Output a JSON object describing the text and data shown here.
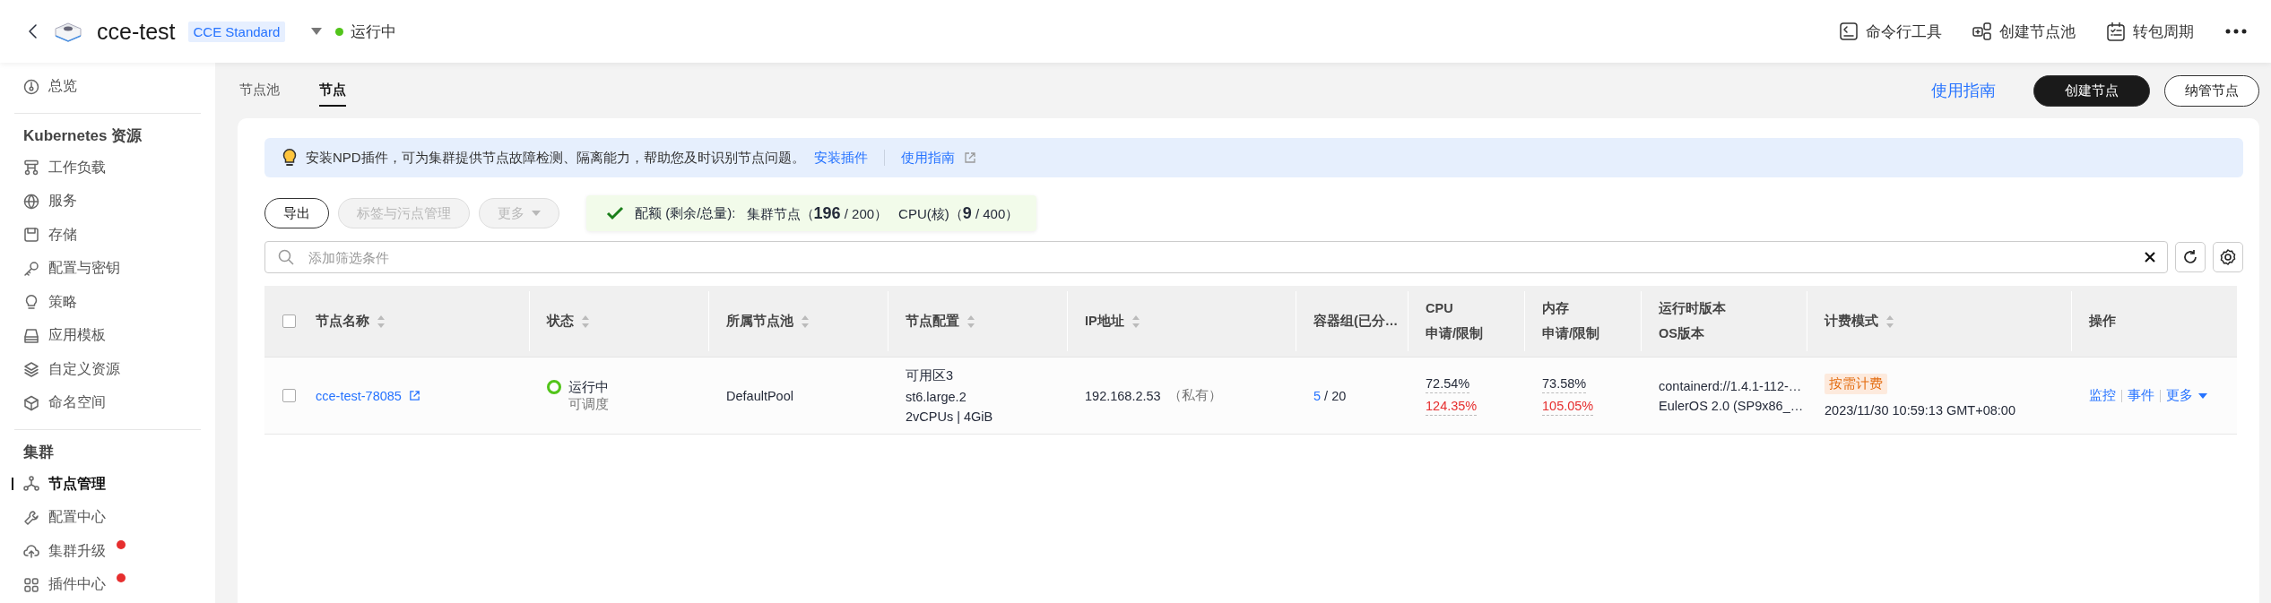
{
  "header": {
    "title": "cce-test",
    "edition": "CCE Standard",
    "status": {
      "label": "运行中",
      "color": "#52c41a"
    },
    "actions": [
      {
        "label": "命令行工具"
      },
      {
        "label": "创建节点池"
      },
      {
        "label": "转包周期"
      }
    ]
  },
  "sidebar": {
    "items": [
      {
        "kind": "item",
        "label": "总览",
        "selected": false,
        "alert": false
      },
      {
        "kind": "divider"
      },
      {
        "kind": "section",
        "label": "Kubernetes 资源"
      },
      {
        "kind": "item",
        "label": "工作负载",
        "selected": false,
        "alert": false
      },
      {
        "kind": "item",
        "label": "服务",
        "selected": false,
        "alert": false
      },
      {
        "kind": "item",
        "label": "存储",
        "selected": false,
        "alert": false
      },
      {
        "kind": "item",
        "label": "配置与密钥",
        "selected": false,
        "alert": false
      },
      {
        "kind": "item",
        "label": "策略",
        "selected": false,
        "alert": false
      },
      {
        "kind": "item",
        "label": "应用模板",
        "selected": false,
        "alert": false
      },
      {
        "kind": "item",
        "label": "自定义资源",
        "selected": false,
        "alert": false
      },
      {
        "kind": "item",
        "label": "命名空间",
        "selected": false,
        "alert": false
      },
      {
        "kind": "divider"
      },
      {
        "kind": "section",
        "label": "集群"
      },
      {
        "kind": "item",
        "label": "节点管理",
        "selected": true,
        "alert": false
      },
      {
        "kind": "item",
        "label": "配置中心",
        "selected": false,
        "alert": false
      },
      {
        "kind": "item",
        "label": "集群升级",
        "selected": false,
        "alert": true
      },
      {
        "kind": "item",
        "label": "插件中心",
        "selected": false,
        "alert": true
      }
    ]
  },
  "tabs": [
    {
      "label": "节点池",
      "selected": false
    },
    {
      "label": "节点",
      "selected": true
    }
  ],
  "page_actions": {
    "guide": "使用指南",
    "buttons": [
      {
        "label": "创建节点",
        "primary": true
      },
      {
        "label": "纳管节点",
        "primary": false
      }
    ]
  },
  "banner": {
    "text": "安装NPD插件，可为集群提供节点故障检测、隔离能力，帮助您及时识别节点问题。",
    "links": [
      "安装插件",
      "使用指南"
    ]
  },
  "toolbar": {
    "buttons": [
      {
        "label": "导出",
        "disabled": false,
        "dropdown": false
      },
      {
        "label": "标签与污点管理",
        "disabled": true,
        "dropdown": false
      },
      {
        "label": "更多",
        "disabled": true,
        "dropdown": true
      }
    ],
    "quota": {
      "label": "配额 (剩余/总量):",
      "items": [
        "集群节点（**196** / 200）",
        "CPU(核)（**9** / 400）"
      ]
    }
  },
  "search": {
    "placeholder": "添加筛选条件"
  },
  "table": {
    "select_all_checked": false,
    "columns": [
      {
        "label": "节点名称",
        "sortable": true
      },
      {
        "label": "状态",
        "sortable": true
      },
      {
        "label": "所属节点池",
        "sortable": true
      },
      {
        "label": "节点配置",
        "sortable": true
      },
      {
        "label": "IP地址",
        "sortable": true
      },
      {
        "label": "容器组(已分…",
        "sortable": false
      },
      {
        "label": "CPU",
        "sublabel": "申请/限制",
        "sortable": false
      },
      {
        "label": "内存",
        "sublabel": "申请/限制",
        "sortable": false
      },
      {
        "label": "运行时版本",
        "sublabel": "OS版本",
        "sortable": false
      },
      {
        "label": "计费模式",
        "sortable": true
      },
      {
        "label": "操作",
        "sortable": false
      }
    ],
    "rows": [
      {
        "checked": false,
        "name": "cce-test-78085",
        "status": "运行中",
        "schedulable": "可调度",
        "pool": "DefaultPool",
        "config": [
          "可用区3",
          "st6.large.2",
          "2vCPUs | 4GiB"
        ],
        "ip": "192.168.2.53",
        "ip_type": "（私有）",
        "pods_used": "5",
        "pods_total": "/ 20",
        "cpu": {
          "request": "72.54%",
          "limit": "124.35%",
          "limit_over": true
        },
        "memory": {
          "request": "73.58%",
          "limit": "105.05%",
          "limit_over": true
        },
        "runtime": "containerd://1.4.1-112-…",
        "os": "EulerOS 2.0 (SP9x86_…",
        "billing": "按需计费",
        "created": "2023/11/30 10:59:13 GMT+08:00",
        "operations": [
          "监控",
          "事件",
          "更多"
        ]
      }
    ]
  }
}
